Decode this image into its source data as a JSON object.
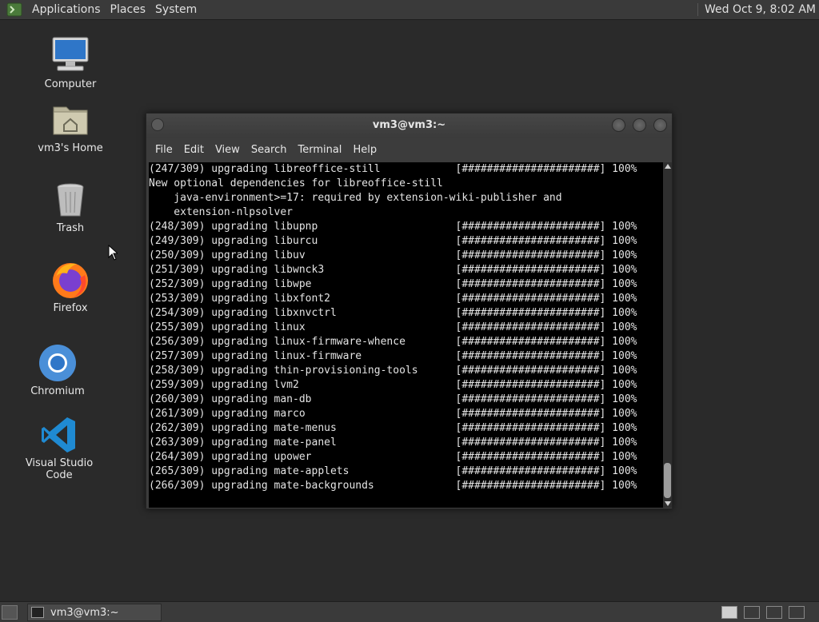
{
  "top_panel": {
    "menus": [
      "Applications",
      "Places",
      "System"
    ],
    "clock": "Wed Oct  9,  8:02 AM"
  },
  "desktop_icons": [
    {
      "label": "Computer",
      "icon": "computer-icon"
    },
    {
      "label": "vm3's Home",
      "icon": "home-folder-icon"
    },
    {
      "label": "Trash",
      "icon": "trash-icon"
    },
    {
      "label": "Firefox",
      "icon": "firefox-icon"
    },
    {
      "label": "Chromium",
      "icon": "chromium-icon"
    },
    {
      "label": "Visual Studio Code",
      "icon": "vscode-icon"
    }
  ],
  "terminal": {
    "title": "vm3@vm3:~",
    "menu": [
      "File",
      "Edit",
      "View",
      "Search",
      "Terminal",
      "Help"
    ],
    "lines": [
      "(247/309) upgrading libreoffice-still            [######################] 100%",
      "New optional dependencies for libreoffice-still",
      "    java-environment>=17: required by extension-wiki-publisher and",
      "    extension-nlpsolver",
      "(248/309) upgrading libupnp                      [######################] 100%",
      "(249/309) upgrading liburcu                      [######################] 100%",
      "(250/309) upgrading libuv                        [######################] 100%",
      "(251/309) upgrading libwnck3                     [######################] 100%",
      "(252/309) upgrading libwpe                       [######################] 100%",
      "(253/309) upgrading libxfont2                    [######################] 100%",
      "(254/309) upgrading libxnvctrl                   [######################] 100%",
      "(255/309) upgrading linux                        [######################] 100%",
      "(256/309) upgrading linux-firmware-whence        [######################] 100%",
      "(257/309) upgrading linux-firmware               [######################] 100%",
      "(258/309) upgrading thin-provisioning-tools      [######################] 100%",
      "(259/309) upgrading lvm2                         [######################] 100%",
      "(260/309) upgrading man-db                       [######################] 100%",
      "(261/309) upgrading marco                        [######################] 100%",
      "(262/309) upgrading mate-menus                   [######################] 100%",
      "(263/309) upgrading mate-panel                   [######################] 100%",
      "(264/309) upgrading upower                       [######################] 100%",
      "(265/309) upgrading mate-applets                 [######################] 100%",
      "(266/309) upgrading mate-backgrounds             [######################] 100%"
    ]
  },
  "taskbar": {
    "window_button": "vm3@vm3:~"
  }
}
